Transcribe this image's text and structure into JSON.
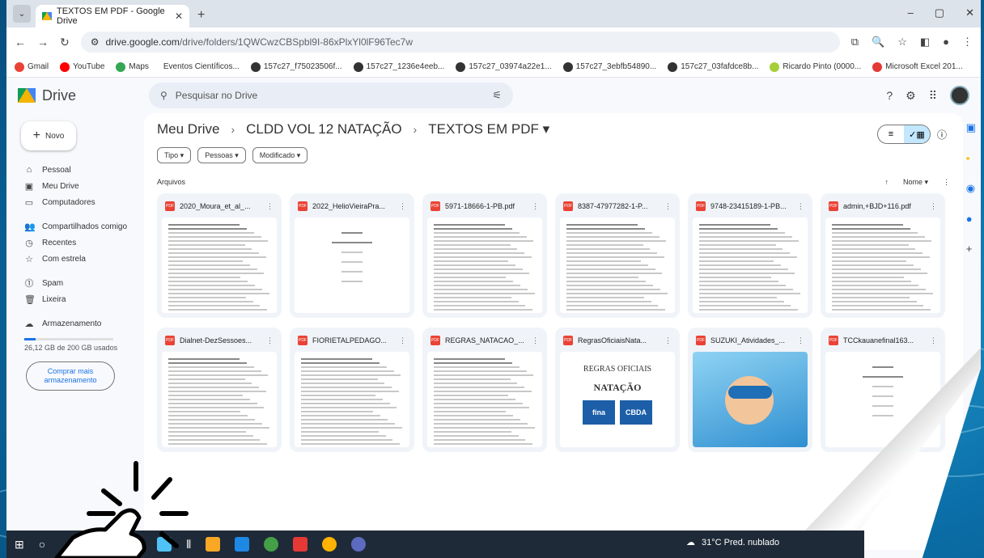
{
  "browser": {
    "tab_title": "TEXTOS EM PDF - Google Drive",
    "tab_close": "✕",
    "new_tab": "+",
    "url_host": "drive.google.com",
    "url_path": "/drive/folders/1QWCwzCBSpbl9I-86xPlxYl0lF96Tec7w",
    "window_controls": [
      "–",
      "▢",
      "✕"
    ]
  },
  "bookmarks": [
    {
      "label": "Gmail",
      "color": "#ea4335"
    },
    {
      "label": "YouTube",
      "color": "#ff0000"
    },
    {
      "label": "Maps",
      "color": "#34a853"
    },
    {
      "label": "Eventos Científicos...",
      "color": ""
    },
    {
      "label": "157c27_f75023506f...",
      "color": "#333333"
    },
    {
      "label": "157c27_1236e4eeb...",
      "color": "#333333"
    },
    {
      "label": "157c27_03974a22e1...",
      "color": "#333333"
    },
    {
      "label": "157c27_3ebfb54890...",
      "color": "#333333"
    },
    {
      "label": "157c27_03fafdce8b...",
      "color": "#333333"
    },
    {
      "label": "Ricardo Pinto (0000...",
      "color": "#a6ce39"
    },
    {
      "label": "Microsoft Excel 201...",
      "color": "#e53935"
    }
  ],
  "drive": {
    "app_name": "Drive",
    "search_placeholder": "Pesquisar no Drive",
    "new_button": "Novo",
    "nav": [
      {
        "label": "Pessoal",
        "icon": "home-icon",
        "glyph": "⌂"
      },
      {
        "label": "Meu Drive",
        "icon": "drive-icon",
        "glyph": "▣"
      },
      {
        "label": "Computadores",
        "icon": "computer-icon",
        "glyph": "▭"
      },
      {
        "label": "Compartilhados comigo",
        "icon": "people-icon",
        "glyph": "👥"
      },
      {
        "label": "Recentes",
        "icon": "clock-icon",
        "glyph": "◷"
      },
      {
        "label": "Com estrela",
        "icon": "star-icon",
        "glyph": "☆"
      },
      {
        "label": "Spam",
        "icon": "spam-icon",
        "glyph": "⓵"
      },
      {
        "label": "Lixeira",
        "icon": "trash-icon",
        "glyph": "🗑"
      },
      {
        "label": "Armazenamento",
        "icon": "cloud-icon",
        "glyph": "☁"
      }
    ],
    "storage_text": "26,12 GB de 200 GB usados",
    "storage_fraction": 0.13,
    "buy_button": "Comprar mais armazenamento",
    "breadcrumb": [
      "Meu Drive",
      "CLDD VOL 12 NATAÇÃO",
      "TEXTOS EM PDF ▾"
    ],
    "filters": [
      "Tipo ▾",
      "Pessoas ▾",
      "Modificado ▾"
    ],
    "section_title": "Arquivos",
    "sort_label": "Nome ▾",
    "files": [
      {
        "name": "2020_Moura_et_al_...",
        "thumb": "doc"
      },
      {
        "name": "2022_HelioVieiraPra...",
        "thumb": "title"
      },
      {
        "name": "5971-18666-1-PB.pdf",
        "thumb": "doc"
      },
      {
        "name": "8387-47977282-1-P...",
        "thumb": "journal"
      },
      {
        "name": "9748-23415189-1-PB...",
        "thumb": "doc"
      },
      {
        "name": "admin,+BJD+116.pdf",
        "thumb": "doc"
      },
      {
        "name": "Dialnet-DezSessoes...",
        "thumb": "doc"
      },
      {
        "name": "FIORIETALPEDAGO...",
        "thumb": "doc"
      },
      {
        "name": "REGRAS_NATACAO_...",
        "thumb": "doc"
      },
      {
        "name": "RegrasOficiaisNata...",
        "thumb": "regras"
      },
      {
        "name": "SUZUKI_Atividades_...",
        "thumb": "photo"
      },
      {
        "name": "TCCkauanefinal163...",
        "thumb": "title"
      }
    ],
    "regras_thumb": {
      "line1": "REGRAS OFICIAIS",
      "line2": "NATAÇÃO",
      "logo1": "fina",
      "logo2": "CBDA"
    }
  },
  "taskbar": {
    "weather": "31°C Pred. nublado"
  }
}
